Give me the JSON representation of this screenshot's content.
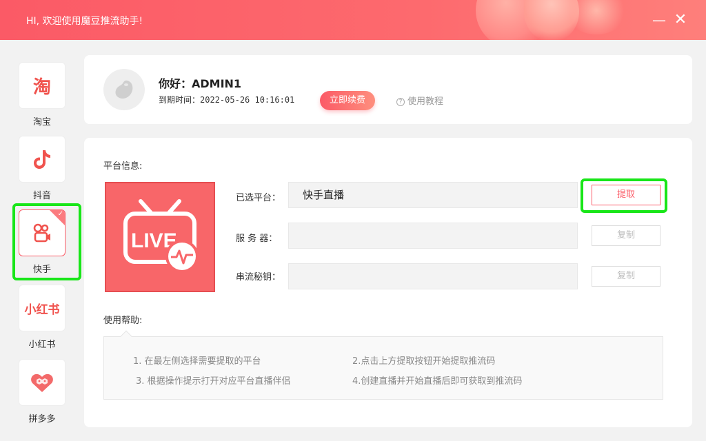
{
  "window": {
    "greeting": "HI, 欢迎使用魔豆推流助手!",
    "min_symbol": "—",
    "close_symbol": "✕",
    "accent_color": "#fb5a66"
  },
  "sidebar": {
    "items": [
      {
        "label": "淘宝",
        "icon": "taobao-icon",
        "glyph": "淘"
      },
      {
        "label": "抖音",
        "icon": "douyin-icon"
      },
      {
        "label": "快手",
        "icon": "kuaishou-icon",
        "selected": true
      },
      {
        "label": "小红书",
        "icon": "xiaohongshu-icon",
        "glyph": "小红书"
      },
      {
        "label": "拼多多",
        "icon": "pinduoduo-icon"
      }
    ]
  },
  "user": {
    "hello": "你好：ADMIN1",
    "expire_label": "到期时间：",
    "expire_value": "2022-05-26 10:16:01",
    "renew_label": "立即续费",
    "tutorial_label": "使用教程"
  },
  "platform": {
    "section_title": "平台信息:",
    "logo_text": "LIVE",
    "selected_label": "已选平台：",
    "selected_value": "快手直播",
    "server_label": "服 务 器：",
    "server_value": "",
    "key_label": "串流秘钥：",
    "key_value": "",
    "extract_label": "提取",
    "copy_label": "复制"
  },
  "help": {
    "section_title": "使用帮助:",
    "steps": [
      "1. 在最左侧选择需要提取的平台",
      "2.点击上方提取按钮开始提取推流码",
      "3. 根据操作提示打开对应平台直播伴侣",
      "4.创建直播并开始直播后即可获取到推流码"
    ]
  }
}
